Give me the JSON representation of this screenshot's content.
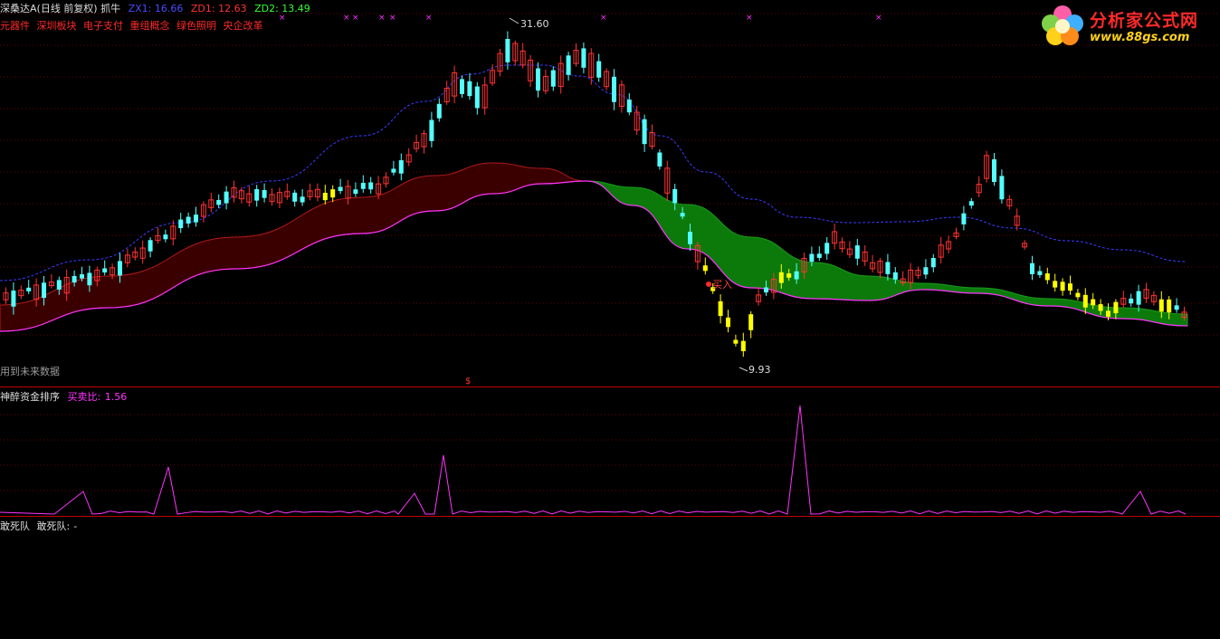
{
  "header": {
    "stock_title": "深桑达A(日线 前复权) 抓牛",
    "zx1": "ZX1: 16.66",
    "zd1": "ZD1: 12.63",
    "zd2": "ZD2: 13.49",
    "concepts": [
      "元器件",
      "深圳板块",
      "电子支付",
      "重组概念",
      "绿色照明",
      "央企改革"
    ]
  },
  "main_chart": {
    "high_label": "31.60",
    "low_label": "9.93",
    "buy_label": "买入",
    "future_data_note": "用到未来数据",
    "dollar_mark": "$"
  },
  "sub_indicator": {
    "name": "神醉资金排序",
    "ratio_label": "买卖比:",
    "ratio_value": "1.56"
  },
  "bottom_indicator": {
    "name": "敢死队",
    "label": "敢死队:",
    "value": "-"
  },
  "logo": {
    "title": "分析家公式网",
    "url": "www.88gs.com"
  },
  "colors": {
    "background": "#000000",
    "up_candle": "#ff3333",
    "down_candle": "#54ffff",
    "buy_bar": "#ffff00",
    "red_band": "#3a0000",
    "green_band": "#0a7a0a",
    "upper_ma": "#3333ff",
    "lower_ma": "#ff33ff",
    "indicator_line": "#ff33ff",
    "grid": "#880000"
  },
  "icons": {
    "signal_marks": "magenta-x-marks",
    "logo_flower": "flower-logo-icon"
  }
}
